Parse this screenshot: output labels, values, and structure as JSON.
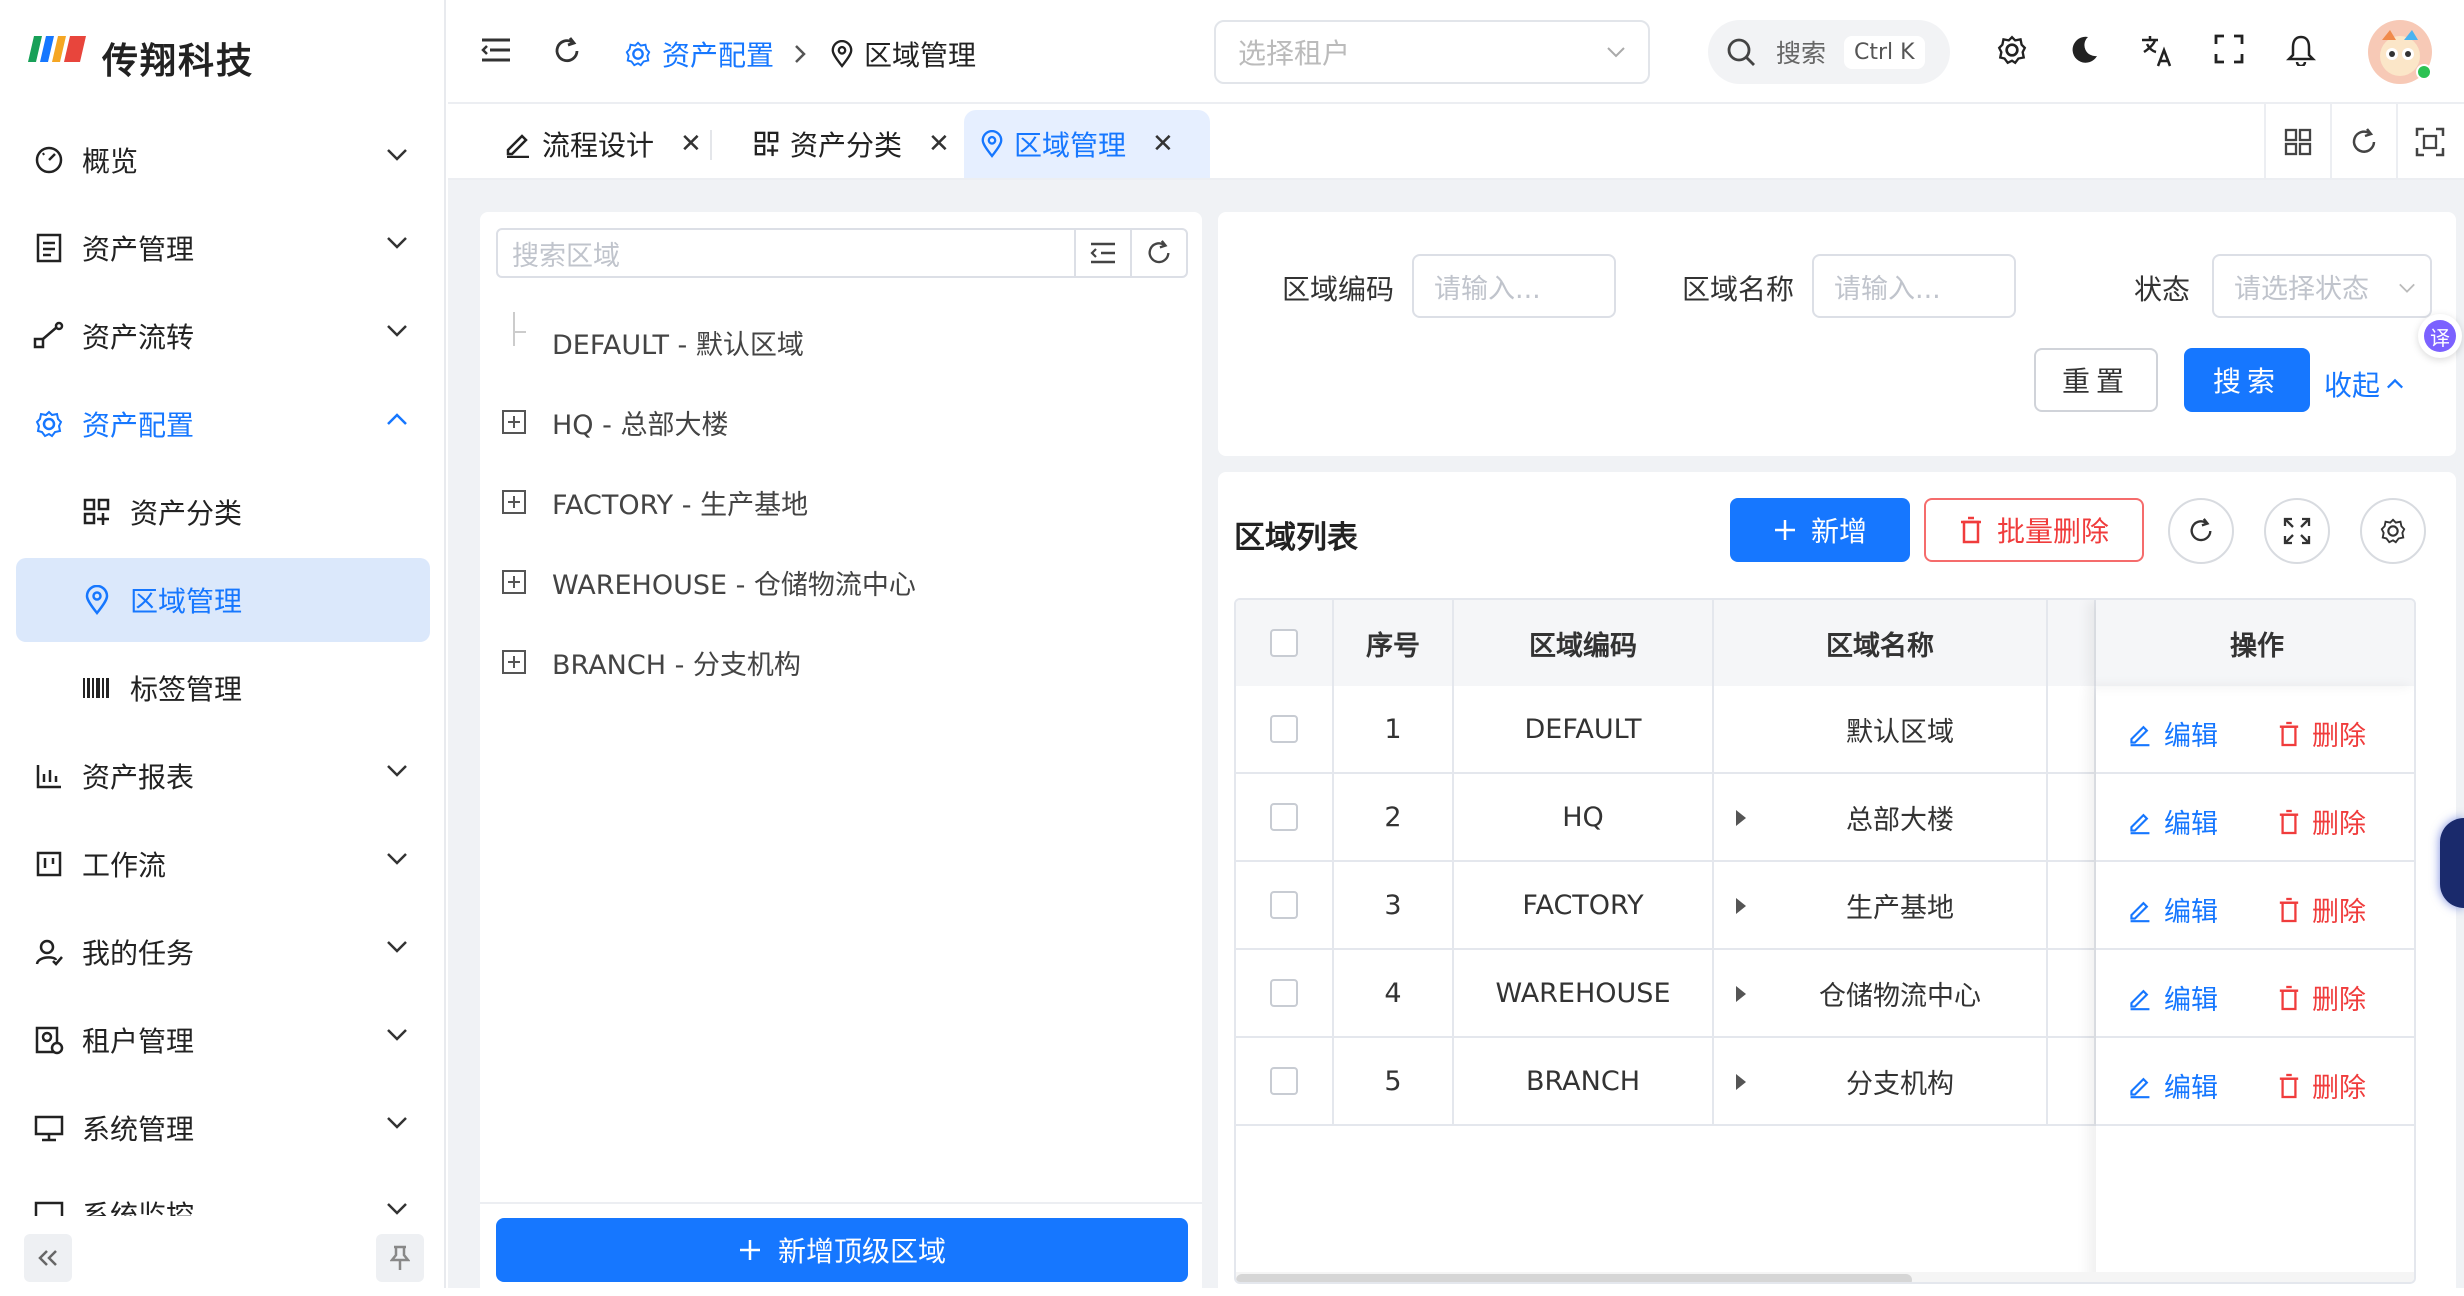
{
  "app": {
    "name": "传翔科技"
  },
  "sidebar": {
    "items": [
      {
        "label": "概览",
        "icon": "gauge-icon"
      },
      {
        "label": "资产管理",
        "icon": "ledger-icon"
      },
      {
        "label": "资产流转",
        "icon": "flow-icon"
      },
      {
        "label": "资产配置",
        "icon": "gear-icon",
        "expanded": true
      },
      {
        "label": "资产分类",
        "icon": "category-icon"
      },
      {
        "label": "区域管理",
        "icon": "location-pin-icon",
        "selected": true
      },
      {
        "label": "标签管理",
        "icon": "barcode-icon"
      },
      {
        "label": "资产报表",
        "icon": "bar-chart-icon"
      },
      {
        "label": "工作流",
        "icon": "kanban-icon"
      },
      {
        "label": "我的任务",
        "icon": "user-task-icon"
      },
      {
        "label": "租户管理",
        "icon": "tenant-icon"
      },
      {
        "label": "系统管理",
        "icon": "monitor-icon"
      },
      {
        "label": "系统监控",
        "icon": "monitor-icon"
      }
    ]
  },
  "header": {
    "breadcrumb": [
      "资产配置",
      "区域管理"
    ],
    "tenant_placeholder": "选择租户",
    "search_label": "搜索",
    "search_shortcut": "Ctrl K"
  },
  "tabs": [
    {
      "label": "流程设计",
      "icon": "edit-icon"
    },
    {
      "label": "资产分类",
      "icon": "category-icon"
    },
    {
      "label": "区域管理",
      "icon": "location-pin-icon",
      "active": true
    }
  ],
  "tree": {
    "search_placeholder": "搜索区域",
    "nodes": [
      "DEFAULT - 默认区域",
      "HQ - 总部大楼",
      "FACTORY - 生产基地",
      "WAREHOUSE - 仓储物流中心",
      "BRANCH - 分支机构"
    ],
    "add_button": "新增顶级区域"
  },
  "filter": {
    "code_label": "区域编码",
    "code_placeholder": "请输入...",
    "name_label": "区域名称",
    "name_placeholder": "请输入...",
    "status_label": "状态",
    "status_placeholder": "请选择状态",
    "reset": "重置",
    "search": "搜索",
    "collapse": "收起"
  },
  "table": {
    "title": "区域列表",
    "add": "新增",
    "batch_delete": "批量删除",
    "columns": [
      "序号",
      "区域编码",
      "区域名称",
      "操作"
    ],
    "rows": [
      {
        "no": "1",
        "code": "DEFAULT",
        "name": "默认区域"
      },
      {
        "no": "2",
        "code": "HQ",
        "name": "总部大楼"
      },
      {
        "no": "3",
        "code": "FACTORY",
        "name": "生产基地"
      },
      {
        "no": "4",
        "code": "WAREHOUSE",
        "name": "仓储物流中心"
      },
      {
        "no": "5",
        "code": "BRANCH",
        "name": "分支机构"
      }
    ],
    "edit": "编辑",
    "delete": "删除"
  },
  "float": {
    "translate": "译"
  },
  "colors": {
    "primary": "#1677ff",
    "danger": "#f03c3c",
    "selected_bg": "#dbe8fb"
  }
}
